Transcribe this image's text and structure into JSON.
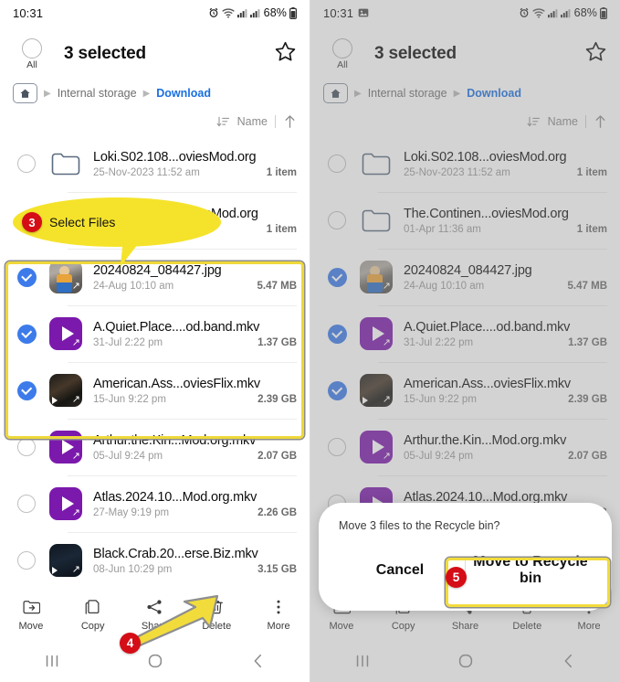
{
  "meta": {
    "accent_blue": "#1a6fe0",
    "check_blue": "#3d7bea",
    "highlight_yellow": "#eed83a",
    "badge_red": "#d40d17",
    "video_purple": "#7b19ac"
  },
  "status_bar": {
    "time": "10:31",
    "battery_percent": "68%",
    "icons": [
      "screenshot-icon",
      "alarm-icon",
      "wifi-icon",
      "signal-icon",
      "signal-icon",
      "battery-icon"
    ]
  },
  "header": {
    "select_all_label": "All",
    "title": "3 selected",
    "favorite_icon": "star-icon"
  },
  "breadcrumb": {
    "home_icon": "home-folder-icon",
    "items": [
      "Internal storage",
      "Download"
    ],
    "active": "Download"
  },
  "sort_bar": {
    "sort_icon": "sort-descending-icon",
    "label": "Name",
    "direction_icon": "arrow-up-icon"
  },
  "files": [
    {
      "name": "Loki.S02.108...oviesMod.org",
      "date": "25-Nov-2023 11:52 am",
      "size": "1 item",
      "type": "folder",
      "selected": false
    },
    {
      "name": "The.Continen...oviesMod.org",
      "date": "01-Apr 11:36 am",
      "size": "1 item",
      "type": "folder",
      "selected": false
    },
    {
      "name": "20240824_084427.jpg",
      "date": "24-Aug 10:10 am",
      "size": "5.47 MB",
      "type": "photo",
      "selected": true
    },
    {
      "name": "A.Quiet.Place....od.band.mkv",
      "date": "31-Jul 2:22 pm",
      "size": "1.37 GB",
      "type": "video",
      "selected": true
    },
    {
      "name": "American.Ass...oviesFlix.mkv",
      "date": "15-Jun 9:22 pm",
      "size": "2.39 GB",
      "type": "video-thumb-dark",
      "selected": true
    },
    {
      "name": "Arthur.the.Kin...Mod.org.mkv",
      "date": "05-Jul 9:24 pm",
      "size": "2.07 GB",
      "type": "video",
      "selected": false
    },
    {
      "name": "Atlas.2024.10...Mod.org.mkv",
      "date": "27-May 9:19 pm",
      "size": "2.26 GB",
      "type": "video",
      "selected": false
    },
    {
      "name": "Black.Crab.20...erse.Biz.mkv",
      "date": "08-Jun 10:29 pm",
      "size": "3.15 GB",
      "type": "video-thumb-dark2",
      "selected": false
    }
  ],
  "toolbar": [
    {
      "label": "Move",
      "icon": "move-to-folder-icon"
    },
    {
      "label": "Copy",
      "icon": "copy-icon"
    },
    {
      "label": "Share",
      "icon": "share-icon"
    },
    {
      "label": "Delete",
      "icon": "trash-icon"
    },
    {
      "label": "More",
      "icon": "more-vertical-icon"
    }
  ],
  "nav_bar": {
    "recents_icon": "recents-icon",
    "home_icon": "home-circle-icon",
    "back_icon": "back-chevron-icon"
  },
  "annotations": {
    "step3": {
      "number": "3",
      "text": "Select Files"
    },
    "step4": {
      "number": "4"
    },
    "step5": {
      "number": "5"
    }
  },
  "dialog": {
    "message": "Move 3 files to the Recycle bin?",
    "cancel_label": "Cancel",
    "confirm_label": "Move to Recycle bin"
  }
}
